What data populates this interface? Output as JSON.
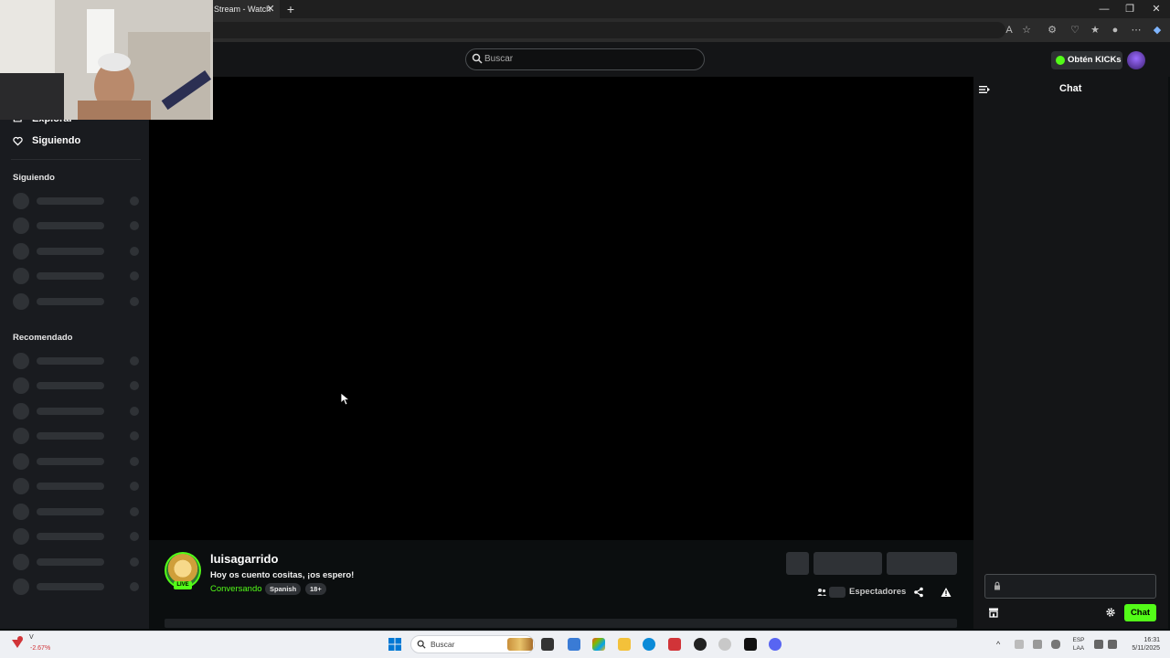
{
  "browser": {
    "tab_title": "Stream - Watch",
    "tab_close": "✕",
    "new_tab": "+",
    "window_controls": [
      "—",
      "❐",
      "✕"
    ]
  },
  "header": {
    "search_placeholder": "Buscar",
    "kicks_label": "Obtén KICKs"
  },
  "sidebar": {
    "nav_items": [
      "Explorar",
      "Siguiendo"
    ],
    "following_header": "Siguiendo",
    "recommended_header": "Recomendado"
  },
  "stream": {
    "streamer_name": "luisagarrido",
    "live_badge": "LIVE",
    "title": "Hoy os cuento cositas, ¡os espero!",
    "category": "Conversando",
    "tags": [
      "Spanish",
      "18+"
    ],
    "viewers_label": "Espectadores"
  },
  "chat": {
    "title": "Chat",
    "send_label": "Chat"
  },
  "taskbar": {
    "stock_label": "V",
    "stock_change": "-2.67%",
    "search_label": "Buscar",
    "lang_line1": "ESP",
    "lang_line2": "LAA",
    "time": "16:31",
    "date": "5/11/2025"
  },
  "colors": {
    "accent": "#53fc18",
    "bg": "#0b0e0f",
    "sidebar_bg": "#191b1f",
    "skeleton": "#2f3236"
  },
  "icons": [
    "search-icon",
    "heart-icon",
    "compass-icon",
    "chat-collapse-icon",
    "lock-icon",
    "store-icon",
    "gear-icon",
    "share-icon",
    "warning-icon",
    "viewers-icon",
    "windows-start-icon"
  ]
}
